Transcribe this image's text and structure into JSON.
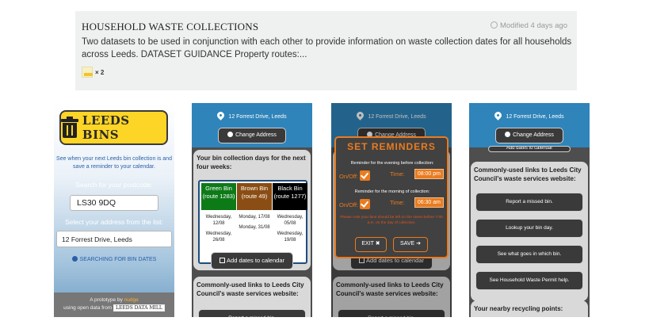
{
  "dataset": {
    "title": "HOUSEHOLD WASTE COLLECTIONS",
    "modified": "Modified 4 days ago",
    "description": "Two datasets to be used in conjunction with each other to provide information on waste collection dates for all households across Leeds. DATASET GUIDANCE Property routes:...",
    "file_count": "× 2"
  },
  "screen1": {
    "logo_text": "LEEDS BINS",
    "intro": "See when your next Leeds bin collection is and save a reminder to your calendar.",
    "postcode_label": "Search for your postcode:",
    "postcode_value": "LS30 9DQ",
    "address_label": "Select your address from the list:",
    "address_value": "12 Forrest Drive, Leeds",
    "searching": "SEARCHING FOR BIN DATES",
    "footer_line1_a": "A prototype by",
    "footer_line1_b": "nudge",
    "footer_line2_a": "using open data from",
    "footer_line2_b": "LEEDS DATA MILL"
  },
  "header": {
    "address": "12 Forrest Drive, Leeds",
    "change_address": "Change Address"
  },
  "screen2": {
    "days_title": "Your bin collection days for the next four weeks:",
    "bins": [
      {
        "name": "Green Bin (route 1283)",
        "color": "#0d7a18",
        "dates": [
          "Wednesday, 12/08",
          "Wednesday, 26/08"
        ]
      },
      {
        "name": "Brown Bin (route 49)",
        "color": "#8a4d13",
        "dates": [
          "Monday, 17/08",
          "Monday, 31/08"
        ]
      },
      {
        "name": "Black Bin (route 1277)",
        "color": "#000000",
        "dates": [
          "Wednesday, 05/08",
          "Wednesday, 19/08"
        ]
      }
    ],
    "add_calendar": "Add dates to calendar",
    "links_title": "Commonly-used links to Leeds City Council's waste services website:",
    "first_link": "Report a missed bin."
  },
  "screen3": {
    "title": "SET REMINDERS",
    "evening_label": "Reminder for the evening before collection:",
    "evening_onoff": "On/Off:",
    "evening_time_label": "Time:",
    "evening_time": "08:00 pm",
    "morning_label": "Reminder for the morning of collection:",
    "morning_onoff": "On/Off:",
    "morning_time_label": "Time:",
    "morning_time": "06:30 am",
    "note": "Please note your bins should be left on the street before 7:00 a.m. on the day of collection.",
    "exit": "EXIT",
    "save": "SAVE",
    "add_calendar": "Add dates to calendar",
    "links_title": "Commonly-used links to Leeds City Council's waste services website:",
    "first_link": "Report a missed bin."
  },
  "screen4": {
    "hidden_btn": "Add dates to calendar",
    "links_title": "Commonly-used links to Leeds City Council's waste services website:",
    "links": [
      "Report a missed bin.",
      "Lookup your bin day.",
      "See what goes in which bin.",
      "See Household Waste Permit help."
    ],
    "recycling_title": "Your nearby recycling points:"
  },
  "colors": {
    "header_blue": "#2f84ba",
    "accent_orange": "#ea7b1f",
    "logo_yellow": "#fcd526"
  }
}
